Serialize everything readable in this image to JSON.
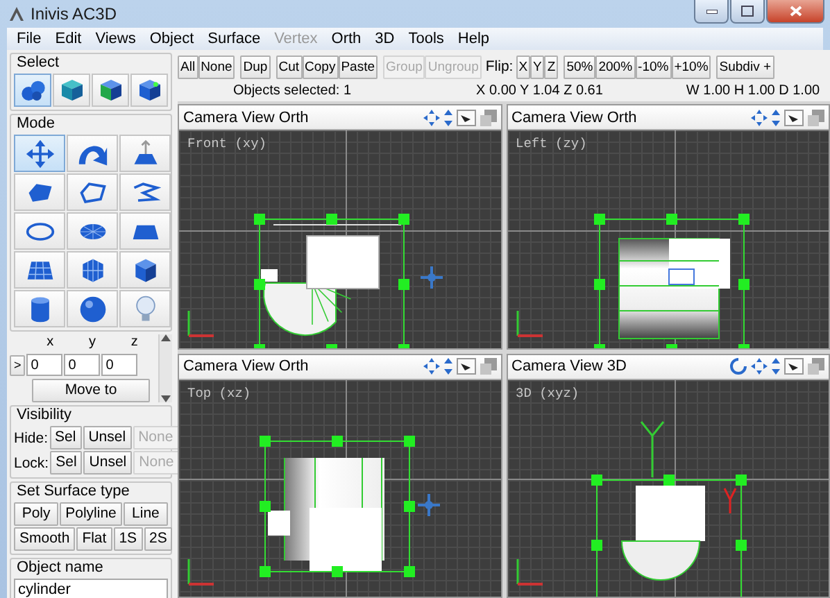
{
  "window": {
    "title": "Inivis AC3D"
  },
  "menu": [
    {
      "label": "File",
      "disabled": false
    },
    {
      "label": "Edit",
      "disabled": false
    },
    {
      "label": "Views",
      "disabled": false
    },
    {
      "label": "Object",
      "disabled": false
    },
    {
      "label": "Surface",
      "disabled": false
    },
    {
      "label": "Vertex",
      "disabled": true
    },
    {
      "label": "Orth",
      "disabled": false
    },
    {
      "label": "3D",
      "disabled": false
    },
    {
      "label": "Tools",
      "disabled": false
    },
    {
      "label": "Help",
      "disabled": false
    }
  ],
  "select_panel": {
    "title": "Select",
    "tools": [
      {
        "selected": true
      },
      {
        "selected": false
      },
      {
        "selected": false
      },
      {
        "selected": false
      }
    ]
  },
  "mode_panel": {
    "title": "Mode",
    "tools": [
      {
        "selected": true
      },
      {
        "selected": false
      },
      {
        "selected": false
      },
      {
        "selected": false
      },
      {
        "selected": false
      },
      {
        "selected": false
      },
      {
        "selected": false
      },
      {
        "selected": false
      },
      {
        "selected": false
      },
      {
        "selected": false
      },
      {
        "selected": false
      },
      {
        "selected": false
      },
      {
        "selected": false
      },
      {
        "selected": false
      },
      {
        "selected": false
      }
    ]
  },
  "coordinates": {
    "axes": [
      "x",
      "y",
      "z"
    ],
    "toggle": ">",
    "values": [
      "0",
      "0",
      "0"
    ],
    "button": "Move to"
  },
  "visibility": {
    "title": "Visibility",
    "rows": [
      {
        "label": "Hide:",
        "buttons": [
          {
            "label": "Sel",
            "disabled": false
          },
          {
            "label": "Unsel",
            "disabled": false
          },
          {
            "label": "None",
            "disabled": true
          }
        ]
      },
      {
        "label": "Lock:",
        "buttons": [
          {
            "label": "Sel",
            "disabled": false
          },
          {
            "label": "Unsel",
            "disabled": false
          },
          {
            "label": "None",
            "disabled": true
          }
        ]
      }
    ]
  },
  "surface_type": {
    "title": "Set Surface type",
    "rows": [
      [
        "Poly",
        "Polyline",
        "Line"
      ],
      [
        "Smooth",
        "Flat",
        "1S",
        "2S"
      ]
    ]
  },
  "object_name": {
    "title": "Object name",
    "value": "cylinder"
  },
  "toolbar": [
    [
      {
        "kind": "button",
        "label": "All",
        "disabled": false
      },
      {
        "kind": "button",
        "label": "None",
        "disabled": false
      }
    ],
    [
      {
        "kind": "button",
        "label": "Dup",
        "disabled": false
      }
    ],
    [
      {
        "kind": "button",
        "label": "Cut",
        "disabled": false
      },
      {
        "kind": "button",
        "label": "Copy",
        "disabled": false
      },
      {
        "kind": "button",
        "label": "Paste",
        "disabled": false
      }
    ],
    [
      {
        "kind": "button",
        "label": "Group",
        "disabled": true
      },
      {
        "kind": "button",
        "label": "Ungroup",
        "disabled": true
      },
      {
        "kind": "label",
        "label": "Flip:"
      },
      {
        "kind": "button",
        "label": "X",
        "disabled": false
      },
      {
        "kind": "button",
        "label": "Y",
        "disabled": false
      },
      {
        "kind": "button",
        "label": "Z",
        "disabled": false
      }
    ],
    [
      {
        "kind": "button",
        "label": "50%",
        "disabled": false
      },
      {
        "kind": "button",
        "label": "200%",
        "disabled": false
      },
      {
        "kind": "button",
        "label": "-10%",
        "disabled": false
      },
      {
        "kind": "button",
        "label": "+10%",
        "disabled": false
      }
    ],
    [
      {
        "kind": "button",
        "label": "Subdiv +",
        "disabled": false
      }
    ]
  ],
  "status": {
    "selection": "Objects selected: 1",
    "position": "X 0.00 Y 1.04 Z 0.61",
    "size": "W 1.00 H 1.00 D 1.00"
  },
  "viewports": [
    {
      "kind": "front",
      "header": "Camera View Orth",
      "label": "Front (xy)"
    },
    {
      "kind": "left",
      "header": "Camera View Orth",
      "label": "Left (zy)"
    },
    {
      "kind": "top",
      "header": "Camera View Orth",
      "label": "Top (xz)"
    },
    {
      "kind": "perspective",
      "header": "Camera View 3D",
      "label": "3D (xyz)"
    }
  ]
}
